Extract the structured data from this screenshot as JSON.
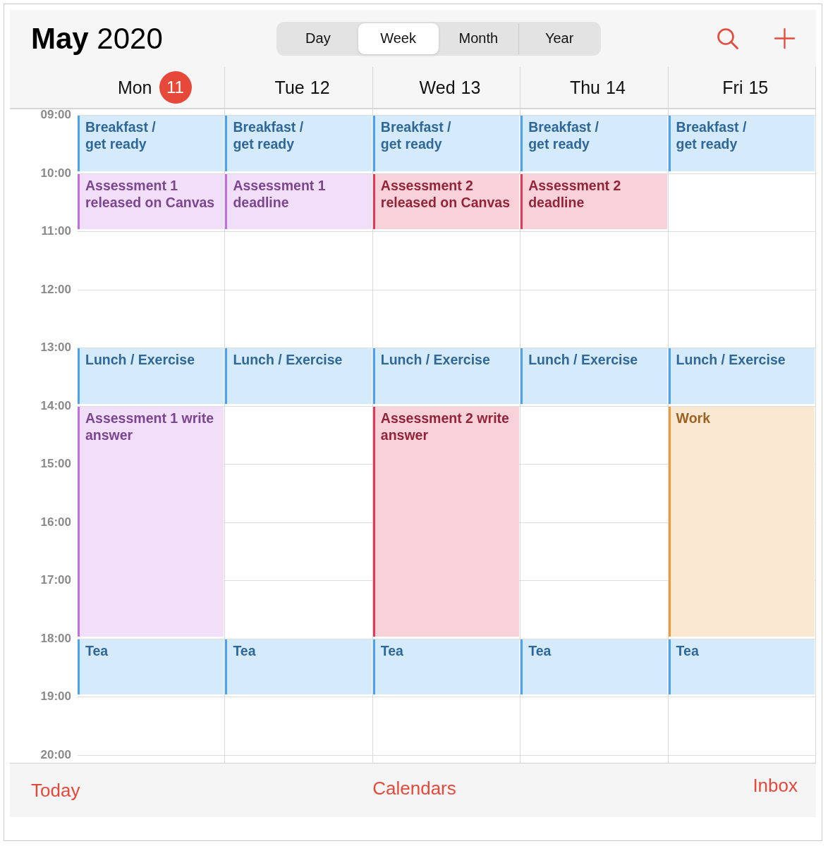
{
  "header": {
    "title": "**May** 2020",
    "views": [
      {
        "label": "Day",
        "selected": false
      },
      {
        "label": "Week",
        "selected": true
      },
      {
        "label": "Month",
        "selected": false
      },
      {
        "label": "Year",
        "selected": false
      }
    ]
  },
  "days": [
    {
      "weekday": "Mon",
      "date": "11",
      "today": true,
      "slots": [
        {
          "kind": "event",
          "title": "Breakfast / get ready",
          "color": "#4aa3ee"
        },
        {
          "kind": "event",
          "title": "Assessment 1 released on Canvas",
          "color": "#c06ee0"
        },
        {
          "kind": "empty"
        },
        {
          "kind": "empty"
        },
        {
          "kind": "event",
          "title": "Lunch / Exercise",
          "color": "#4aa3ee"
        },
        {
          "kind": "event",
          "title": "Assessment 1 write answer",
          "color": "#c06ee0"
        },
        {
          "kind": "continued"
        },
        {
          "kind": "continued"
        },
        {
          "kind": "continued"
        },
        {
          "kind": "event",
          "title": "Tea",
          "color": "#4aa3ee"
        },
        {
          "kind": "empty"
        }
      ]
    },
    {
      "weekday": "Tue",
      "date": "12",
      "today": false,
      "slots": [
        {
          "kind": "event",
          "title": "Breakfast / get ready",
          "color": "#4aa3ee"
        },
        {
          "kind": "event",
          "title": "Assessment 1 deadline",
          "color": "#c06ee0"
        },
        {
          "kind": "empty"
        },
        {
          "kind": "empty"
        },
        {
          "kind": "event",
          "title": "Lunch / Exercise",
          "color": "#4aa3ee"
        },
        {
          "kind": "empty"
        },
        {
          "kind": "empty"
        },
        {
          "kind": "empty"
        },
        {
          "kind": "empty"
        },
        {
          "kind": "event",
          "title": "Tea",
          "color": "#4aa3ee"
        },
        {
          "kind": "empty"
        }
      ]
    },
    {
      "weekday": "Wed",
      "date": "13",
      "today": false,
      "slots": [
        {
          "kind": "event",
          "title": "Breakfast / get ready",
          "color": "#4aa3ee"
        },
        {
          "kind": "event",
          "title": "Assessment 2 released on Canvas",
          "color": "#e4395a"
        },
        {
          "kind": "empty"
        },
        {
          "kind": "empty"
        },
        {
          "kind": "event",
          "title": "Lunch / Exercise",
          "color": "#4aa3ee"
        },
        {
          "kind": "event",
          "title": "Assessment 2 write answer",
          "color": "#e4395a"
        },
        {
          "kind": "continued"
        },
        {
          "kind": "continued"
        },
        {
          "kind": "continued"
        },
        {
          "kind": "event",
          "title": "Tea",
          "color": "#4aa3ee"
        },
        {
          "kind": "empty"
        }
      ]
    },
    {
      "weekday": "Thu",
      "date": "14",
      "today": false,
      "slots": [
        {
          "kind": "event",
          "title": "Breakfast / get ready",
          "color": "#4aa3ee"
        },
        {
          "kind": "event",
          "title": "Assessment 2 deadline",
          "color": "#e4395a"
        },
        {
          "kind": "empty"
        },
        {
          "kind": "empty"
        },
        {
          "kind": "event",
          "title": "Lunch / Exercise",
          "color": "#4aa3ee"
        },
        {
          "kind": "empty"
        },
        {
          "kind": "empty"
        },
        {
          "kind": "empty"
        },
        {
          "kind": "empty"
        },
        {
          "kind": "event",
          "title": "Tea",
          "color": "#4aa3ee"
        },
        {
          "kind": "empty"
        }
      ]
    },
    {
      "weekday": "Fri",
      "date": "15",
      "today": false,
      "slots": [
        {
          "kind": "event",
          "title": "Breakfast / get ready",
          "color": "#4aa3ee"
        },
        {
          "kind": "empty"
        },
        {
          "kind": "empty"
        },
        {
          "kind": "empty"
        },
        {
          "kind": "event",
          "title": "Lunch / Exercise",
          "color": "#4aa3ee"
        },
        {
          "kind": "event",
          "title": "Work",
          "color": "#ef9a3a"
        },
        {
          "kind": "continued"
        },
        {
          "kind": "continued"
        },
        {
          "kind": "continued"
        },
        {
          "kind": "event",
          "title": "Tea",
          "color": "#4aa3ee"
        },
        {
          "kind": "empty"
        }
      ]
    }
  ],
  "hours": [
    "09:00",
    "10:00",
    "11:00",
    "12:00",
    "13:00",
    "14:00",
    "15:00",
    "16:00",
    "17:00",
    "18:00",
    "19:00",
    "20:00"
  ],
  "toolbar": [
    "Today",
    "Calendars",
    "Inbox"
  ]
}
